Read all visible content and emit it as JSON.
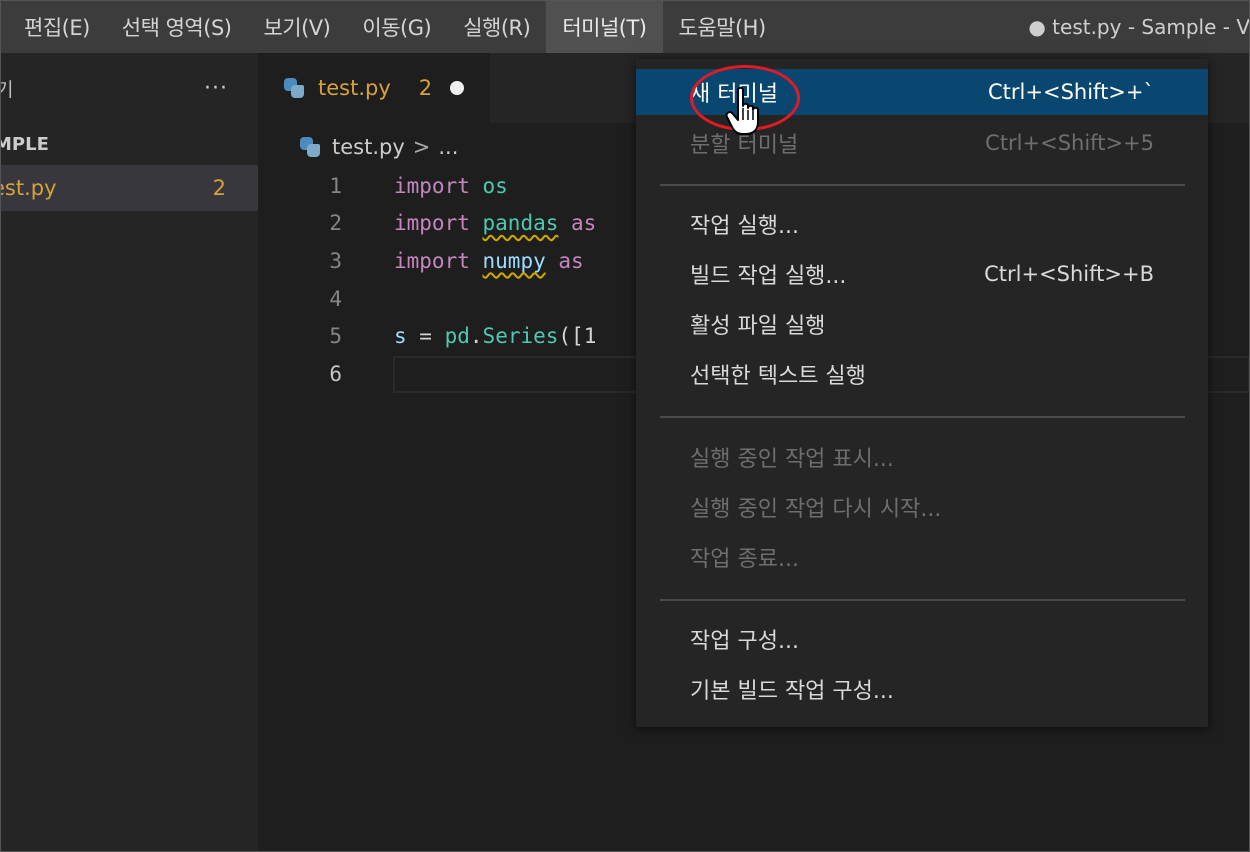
{
  "menubar": {
    "items": [
      "편집(E)",
      "선택 영역(S)",
      "보기(V)",
      "이동(G)",
      "실행(R)",
      "터미널(T)",
      "도움말(H)"
    ],
    "window_title": "● test.py - Sample - V"
  },
  "sidebar": {
    "header_title": "기",
    "more_label": "···",
    "section_label": "MPLE",
    "file_name": "est.py",
    "file_problems": "2"
  },
  "editor": {
    "tab": {
      "name": "test.py",
      "problems": "2"
    },
    "breadcrumb": {
      "file": "test.py",
      "sep": ">",
      "rest": "..."
    },
    "line_numbers": [
      "1",
      "2",
      "3",
      "4",
      "5",
      "6"
    ],
    "lines": [
      [
        {
          "t": "import",
          "c": "kw"
        },
        {
          "t": " ",
          "c": ""
        },
        {
          "t": "os",
          "c": "mod"
        }
      ],
      [
        {
          "t": "import",
          "c": "kw"
        },
        {
          "t": " ",
          "c": ""
        },
        {
          "t": "pandas",
          "c": "mod squig"
        },
        {
          "t": " ",
          "c": ""
        },
        {
          "t": "as",
          "c": "kw"
        }
      ],
      [
        {
          "t": "import",
          "c": "kw"
        },
        {
          "t": " ",
          "c": ""
        },
        {
          "t": "numpy",
          "c": "var squig"
        },
        {
          "t": " ",
          "c": ""
        },
        {
          "t": "as",
          "c": "kw"
        }
      ],
      [],
      [
        {
          "t": "s",
          "c": "var"
        },
        {
          "t": " = ",
          "c": ""
        },
        {
          "t": "pd",
          "c": "mod"
        },
        {
          "t": ".",
          "c": ""
        },
        {
          "t": "Series",
          "c": "mod"
        },
        {
          "t": "([1",
          "c": ""
        }
      ],
      []
    ]
  },
  "terminal_menu": {
    "items": [
      {
        "label": "새 터미널",
        "shortcut": "Ctrl+<Shift>+`",
        "state": "hover"
      },
      {
        "label": "분할 터미널",
        "shortcut": "Ctrl+<Shift>+5",
        "state": "disabled"
      },
      {
        "label": "작업 실행...",
        "shortcut": "",
        "state": "enabled"
      },
      {
        "label": "빌드 작업 실행...",
        "shortcut": "Ctrl+<Shift>+B",
        "state": "enabled"
      },
      {
        "label": "활성 파일 실행",
        "shortcut": "",
        "state": "enabled"
      },
      {
        "label": "선택한 텍스트 실행",
        "shortcut": "",
        "state": "enabled"
      },
      {
        "label": "실행 중인 작업 표시...",
        "shortcut": "",
        "state": "disabled"
      },
      {
        "label": "실행 중인 작업 다시 시작...",
        "shortcut": "",
        "state": "disabled"
      },
      {
        "label": "작업 종료...",
        "shortcut": "",
        "state": "disabled"
      },
      {
        "label": "작업 구성...",
        "shortcut": "",
        "state": "enabled"
      },
      {
        "label": "기본 빌드 작업 구성...",
        "shortcut": "",
        "state": "enabled"
      }
    ]
  },
  "colors": {
    "accent": "#094771",
    "annotation_ring": "#e01b24",
    "modified_file": "#d7a23b"
  }
}
